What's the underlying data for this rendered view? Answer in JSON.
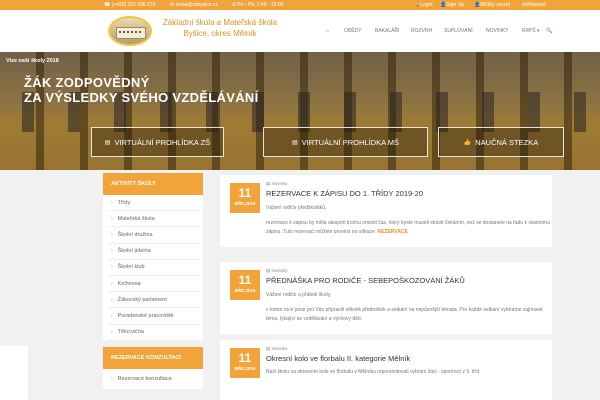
{
  "topbar": {
    "phone": "☎ (+420) 315 696 279",
    "email": "✉ skola@zsbysice.cz",
    "hours": "⏱ Po - Pá: 7:45 - 15:00",
    "login": "Login",
    "signup": "Sign Up",
    "moje": "Mřížky secret",
    "webmail": "Webmail"
  },
  "logo": {
    "line1": "Základní škola a Mateřská škola",
    "line2": "Byšice, okres Mělník"
  },
  "nav": {
    "items": [
      "OBĚDY",
      "BAKALÁŘI",
      "ROZVRH",
      "SUPLOVÁNÍ",
      "NOVINKY",
      "KRPŠ ▾"
    ]
  },
  "hero": {
    "tag": "Vize naší školy 2018",
    "title_line1": "ŽÁK ZODPOVĚDNÝ",
    "title_line2": "ZA VÝSLEDKY SVÉHO VZDĚLÁVÁNÍ",
    "buttons": [
      "VIRTUÁLNÍ PROHLÍDKA ZŠ",
      "VIRTUÁLNÍ PROHLÍDKA MŠ",
      "NAUČNÁ STEZKA"
    ]
  },
  "sidebar": {
    "heading": "AKTIVITY ŠKOLY",
    "items": [
      "Třídy",
      "Mateřská škola",
      "Školní družina",
      "Školní jídelna",
      "Školní klub",
      "Knihovna",
      "Žákovský parlament",
      "Poradenské pracoviště",
      "Tělocvična"
    ],
    "heading2": "REZERVACE KONZULTACÍ",
    "items2": [
      "Rezervace konzultace"
    ]
  },
  "news": [
    {
      "day": "11",
      "month": "BŘE,2019",
      "category": "Novinky",
      "title": "REZERVACE K ZÁPISU DO 1. TŘÍDY 2019-20",
      "p1": "Vážení rodiče předškoláků,",
      "p2": "rezervace k zápisu by měla alespoň trochu omezit čas, který byste museli strávit čekáním, než se dostanete na řadu k vlastnímu zápisu. Tuto rezervaci můžete provést na odkaze:",
      "link": "REZERVACE"
    },
    {
      "day": "11",
      "month": "BŘE,2019",
      "category": "Novinky",
      "title": "PŘEDNÁŠKA PRO RODIČE - SEBEPOŠKOZOVÁNÍ ŽÁKŮ",
      "p1": "Vážení rodiče a přátelé školy,",
      "p2": "v tomto roce jsme pro Vás připravili několik přednášek a setkání na nejrůznější témata. Pro každé setkání vybíráme zajímavé téma, týkající se vzdělávání a výchovy dětí."
    },
    {
      "day": "11",
      "month": "BŘE,2019",
      "category": "Novinky",
      "title": "Okresní kolo ve florbalu II. kategorie Mělník",
      "p1": "Naši školu na okresním kole ve florbalu v Mělníku reprezentovali vybraní žáci - sportovci z 5. tříd."
    }
  ],
  "colors": {
    "accent": "#f2a43a",
    "link": "#e89420"
  }
}
